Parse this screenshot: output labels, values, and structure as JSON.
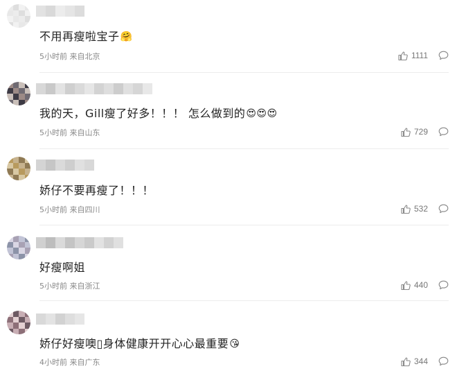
{
  "comments": [
    {
      "text": "不用再瘦啦宝子",
      "emoji": "🤗",
      "time": "5小时前",
      "location": "来自北京",
      "likes": "1111",
      "avatar_colors": [
        "#ececec",
        "#e8e8e8",
        "#f2f2f2",
        "#dedede"
      ],
      "name_colors": [
        "#e2e2e2",
        "#d9d9d9",
        "#ececec",
        "#e5e5e5",
        "#dcdcdc"
      ]
    },
    {
      "text": "我的天，Gill瘦了好多！！！ 怎么做到的",
      "emoji": "😍😍😍",
      "time": "5小时前",
      "location": "来自山东",
      "likes": "729",
      "avatar_colors": [
        "#9c8a86",
        "#3d3a44",
        "#c9bfb9",
        "#6f6a72"
      ],
      "name_colors": [
        "#d8d8d8",
        "#c9c9c9",
        "#e3e3e3",
        "#cfcfcf",
        "#dadada",
        "#e6e6e6",
        "#d3d3d3",
        "#dedede",
        "#cdcdcd",
        "#e0e0e0",
        "#d6d6d6",
        "#e8e8e8"
      ]
    },
    {
      "text": "娇仔不要再瘦了！！！",
      "emoji": "",
      "time": "5小时前",
      "location": "来自四川",
      "likes": "532",
      "avatar_colors": [
        "#b89a5e",
        "#d8c8a4",
        "#8f7a55",
        "#c6b28e"
      ],
      "name_colors": [
        "#d4d4d4",
        "#c6c6c6",
        "#dadada",
        "#cecece",
        "#e0e0e0",
        "#d8d8d8"
      ]
    },
    {
      "text": "好瘦啊姐",
      "emoji": "",
      "time": "5小时前",
      "location": "来自浙江",
      "likes": "440",
      "avatar_colors": [
        "#d9d6e4",
        "#8c93a8",
        "#c2c4d6",
        "#a8a1b4"
      ],
      "name_colors": [
        "#d0d0d0",
        "#bdbdbd",
        "#dadada",
        "#c4c4c4",
        "#d6d6d6",
        "#cacaca",
        "#e2e2e2",
        "#d2d2d2",
        "#e0e0e0"
      ]
    },
    {
      "text": "娇仔好瘦噢▯身体健康开开心心最重要",
      "emoji": "😘",
      "time": "4小时前",
      "location": "来自广东",
      "likes": "344",
      "avatar_colors": [
        "#e4d0d2",
        "#8d6f78",
        "#c8aeb4",
        "#6e5a63"
      ],
      "name_colors": [
        "#d9d9d9",
        "#e3e3e3",
        "#d2d2d2",
        "#dedede",
        "#e6e6e6"
      ]
    }
  ],
  "icons": {
    "like": "thumb-up-icon",
    "reply": "speech-bubble-icon"
  },
  "colors": {
    "text": "#222222",
    "meta": "#888888",
    "divider": "#ececec"
  }
}
